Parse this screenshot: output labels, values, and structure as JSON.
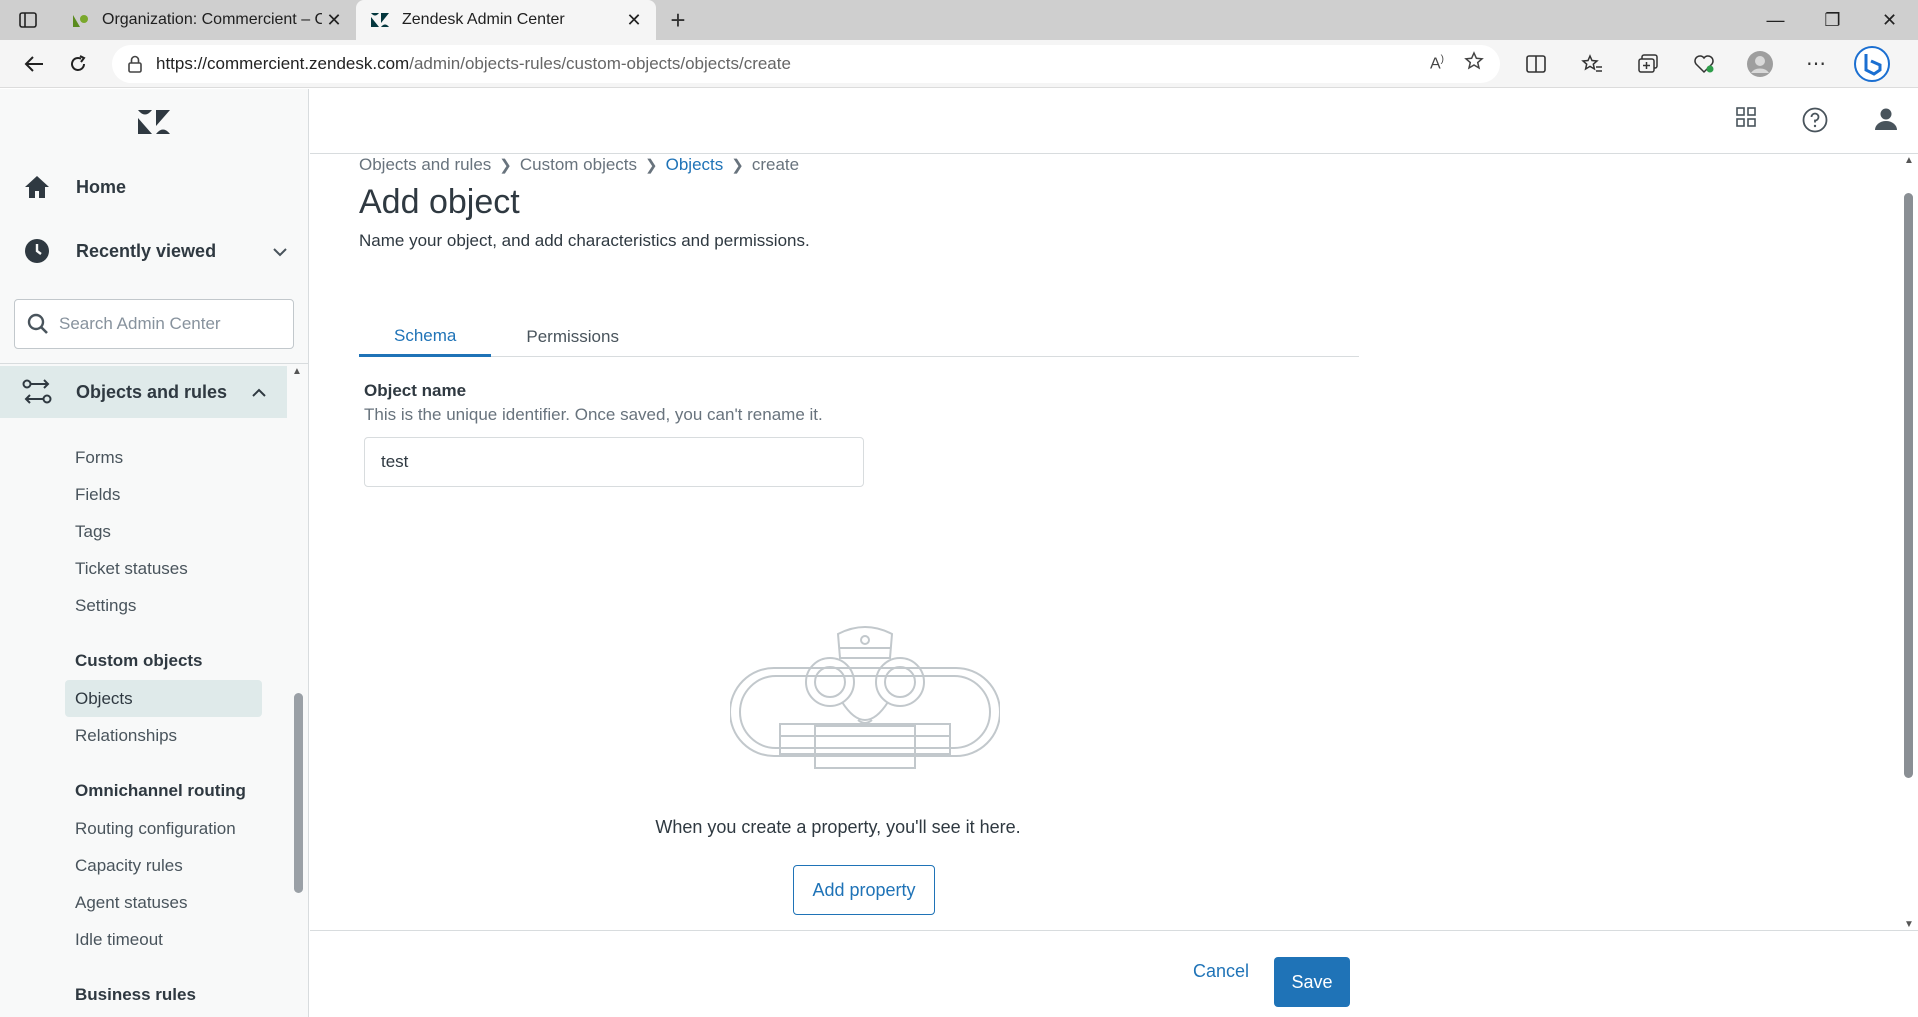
{
  "browser": {
    "tabs": [
      {
        "title": "Organization: Commercient – Co",
        "favicon": "zendesk-green-icon"
      },
      {
        "title": "Zendesk Admin Center",
        "favicon": "zendesk-icon",
        "active": true
      }
    ],
    "url_host": "https://commercient.zendesk.com",
    "url_path": "/admin/objects-rules/custom-objects/objects/create"
  },
  "sidebar": {
    "home": "Home",
    "recently_viewed": "Recently viewed",
    "search_placeholder": "Search Admin Center",
    "section": "Objects and rules",
    "items": [
      "Forms",
      "Fields",
      "Tags",
      "Ticket statuses",
      "Settings"
    ],
    "custom_objects": {
      "heading": "Custom objects",
      "items": [
        "Objects",
        "Relationships"
      ],
      "selected": "Objects"
    },
    "omnichannel": {
      "heading": "Omnichannel routing",
      "items": [
        "Routing configuration",
        "Capacity rules",
        "Agent statuses",
        "Idle timeout"
      ]
    },
    "business_rules": "Business rules"
  },
  "breadcrumb": [
    "Objects and rules",
    "Custom objects",
    "Objects",
    "create"
  ],
  "page": {
    "title": "Add object",
    "subtitle": "Name your object, and add characteristics and permissions.",
    "tabs": [
      "Schema",
      "Permissions"
    ],
    "active_tab": "Schema",
    "object_name_label": "Object name",
    "object_name_hint": "This is the unique identifier. Once saved, you can't rename it.",
    "object_name_value": "test",
    "empty_text": "When you create a property, you'll see it here.",
    "add_property": "Add property"
  },
  "footer": {
    "cancel": "Cancel",
    "save": "Save"
  },
  "colors": {
    "accent": "#1f73b7",
    "selected_bg": "#dfeaea"
  }
}
